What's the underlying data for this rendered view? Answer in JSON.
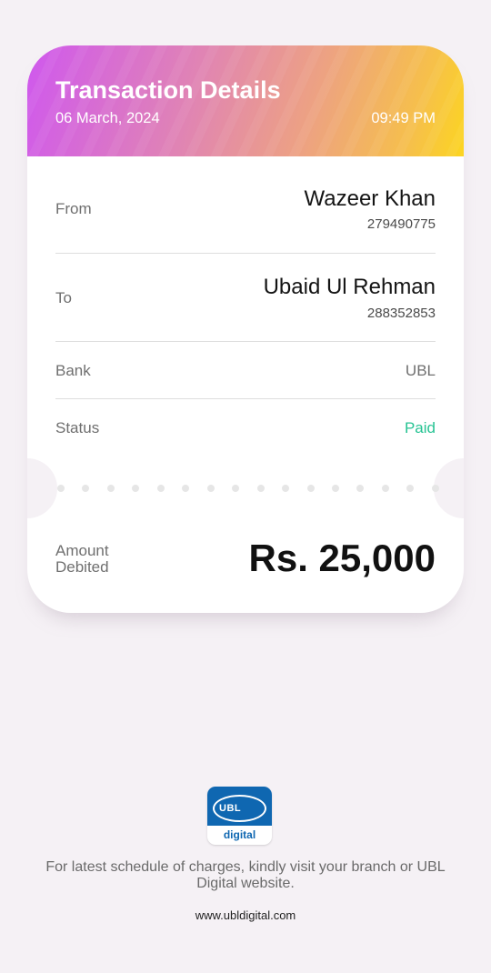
{
  "header": {
    "title": "Transaction Details",
    "date": "06 March, 2024",
    "time": "09:49 PM"
  },
  "from": {
    "label": "From",
    "name": "Wazeer Khan",
    "account": "279490775"
  },
  "to": {
    "label": "To",
    "name": "Ubaid Ul Rehman",
    "account": "288352853"
  },
  "bank": {
    "label": "Bank",
    "value": "UBL"
  },
  "status": {
    "label": "Status",
    "value": "Paid",
    "color": "#27c393"
  },
  "amount": {
    "label": "Amount Debited",
    "value": "Rs. 25,000"
  },
  "logo": {
    "icon": "ubl-digital-logo",
    "brand": "UBL",
    "subtitle": "digital",
    "color": "#0f67b1"
  },
  "footer": {
    "note": "For latest schedule of charges, kindly visit your branch or UBL Digital website.",
    "url": "www.ubldigital.com"
  }
}
